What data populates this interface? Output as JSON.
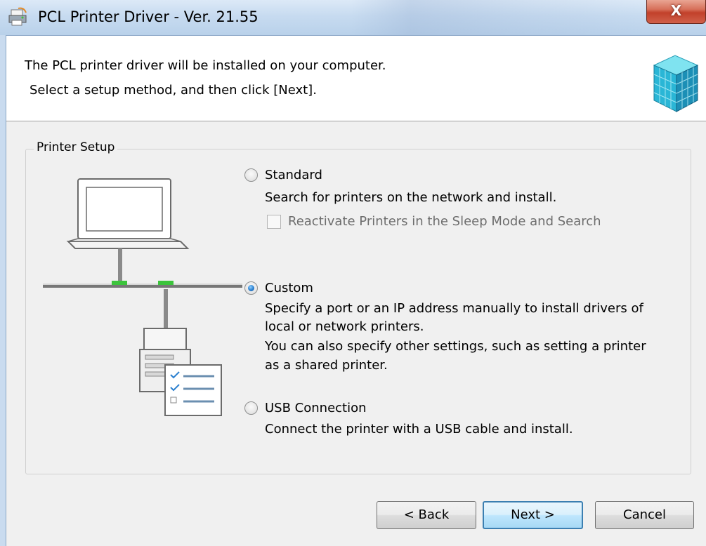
{
  "window": {
    "title": "PCL Printer Driver - Ver. 21.55",
    "close_label": "X"
  },
  "header": {
    "line1": "The PCL printer driver will be installed on your computer.",
    "line2": "Select a setup method, and then click [Next]."
  },
  "printer_setup": {
    "group_label": "Printer Setup",
    "selected": "custom",
    "options": [
      {
        "id": "standard",
        "label": "Standard",
        "description": [
          "Search for printers on the network and install."
        ],
        "checked": false
      },
      {
        "id": "custom",
        "label": "Custom",
        "description": [
          "Specify a port or an IP address manually to install drivers of",
          "local or network printers.",
          "You can also specify other settings, such as setting a printer",
          "as a shared printer."
        ],
        "checked": true
      },
      {
        "id": "usb",
        "label": "USB Connection",
        "description": [
          "Connect the printer with a USB cable and install."
        ],
        "checked": false
      }
    ],
    "sleep_mode_checkbox": {
      "label": "Reactivate Printers in the Sleep Mode and Search",
      "checked": false,
      "enabled": false
    }
  },
  "buttons": {
    "back": "< Back",
    "next": "Next >",
    "cancel": "Cancel"
  },
  "colors": {
    "accent": "#3c7fb1",
    "close": "#c2412b",
    "network_port": "#3cc43c"
  },
  "icons": [
    "printer-driver-icon",
    "setup-cube-icon",
    "laptop-icon",
    "printer-icon",
    "checklist-icon"
  ]
}
